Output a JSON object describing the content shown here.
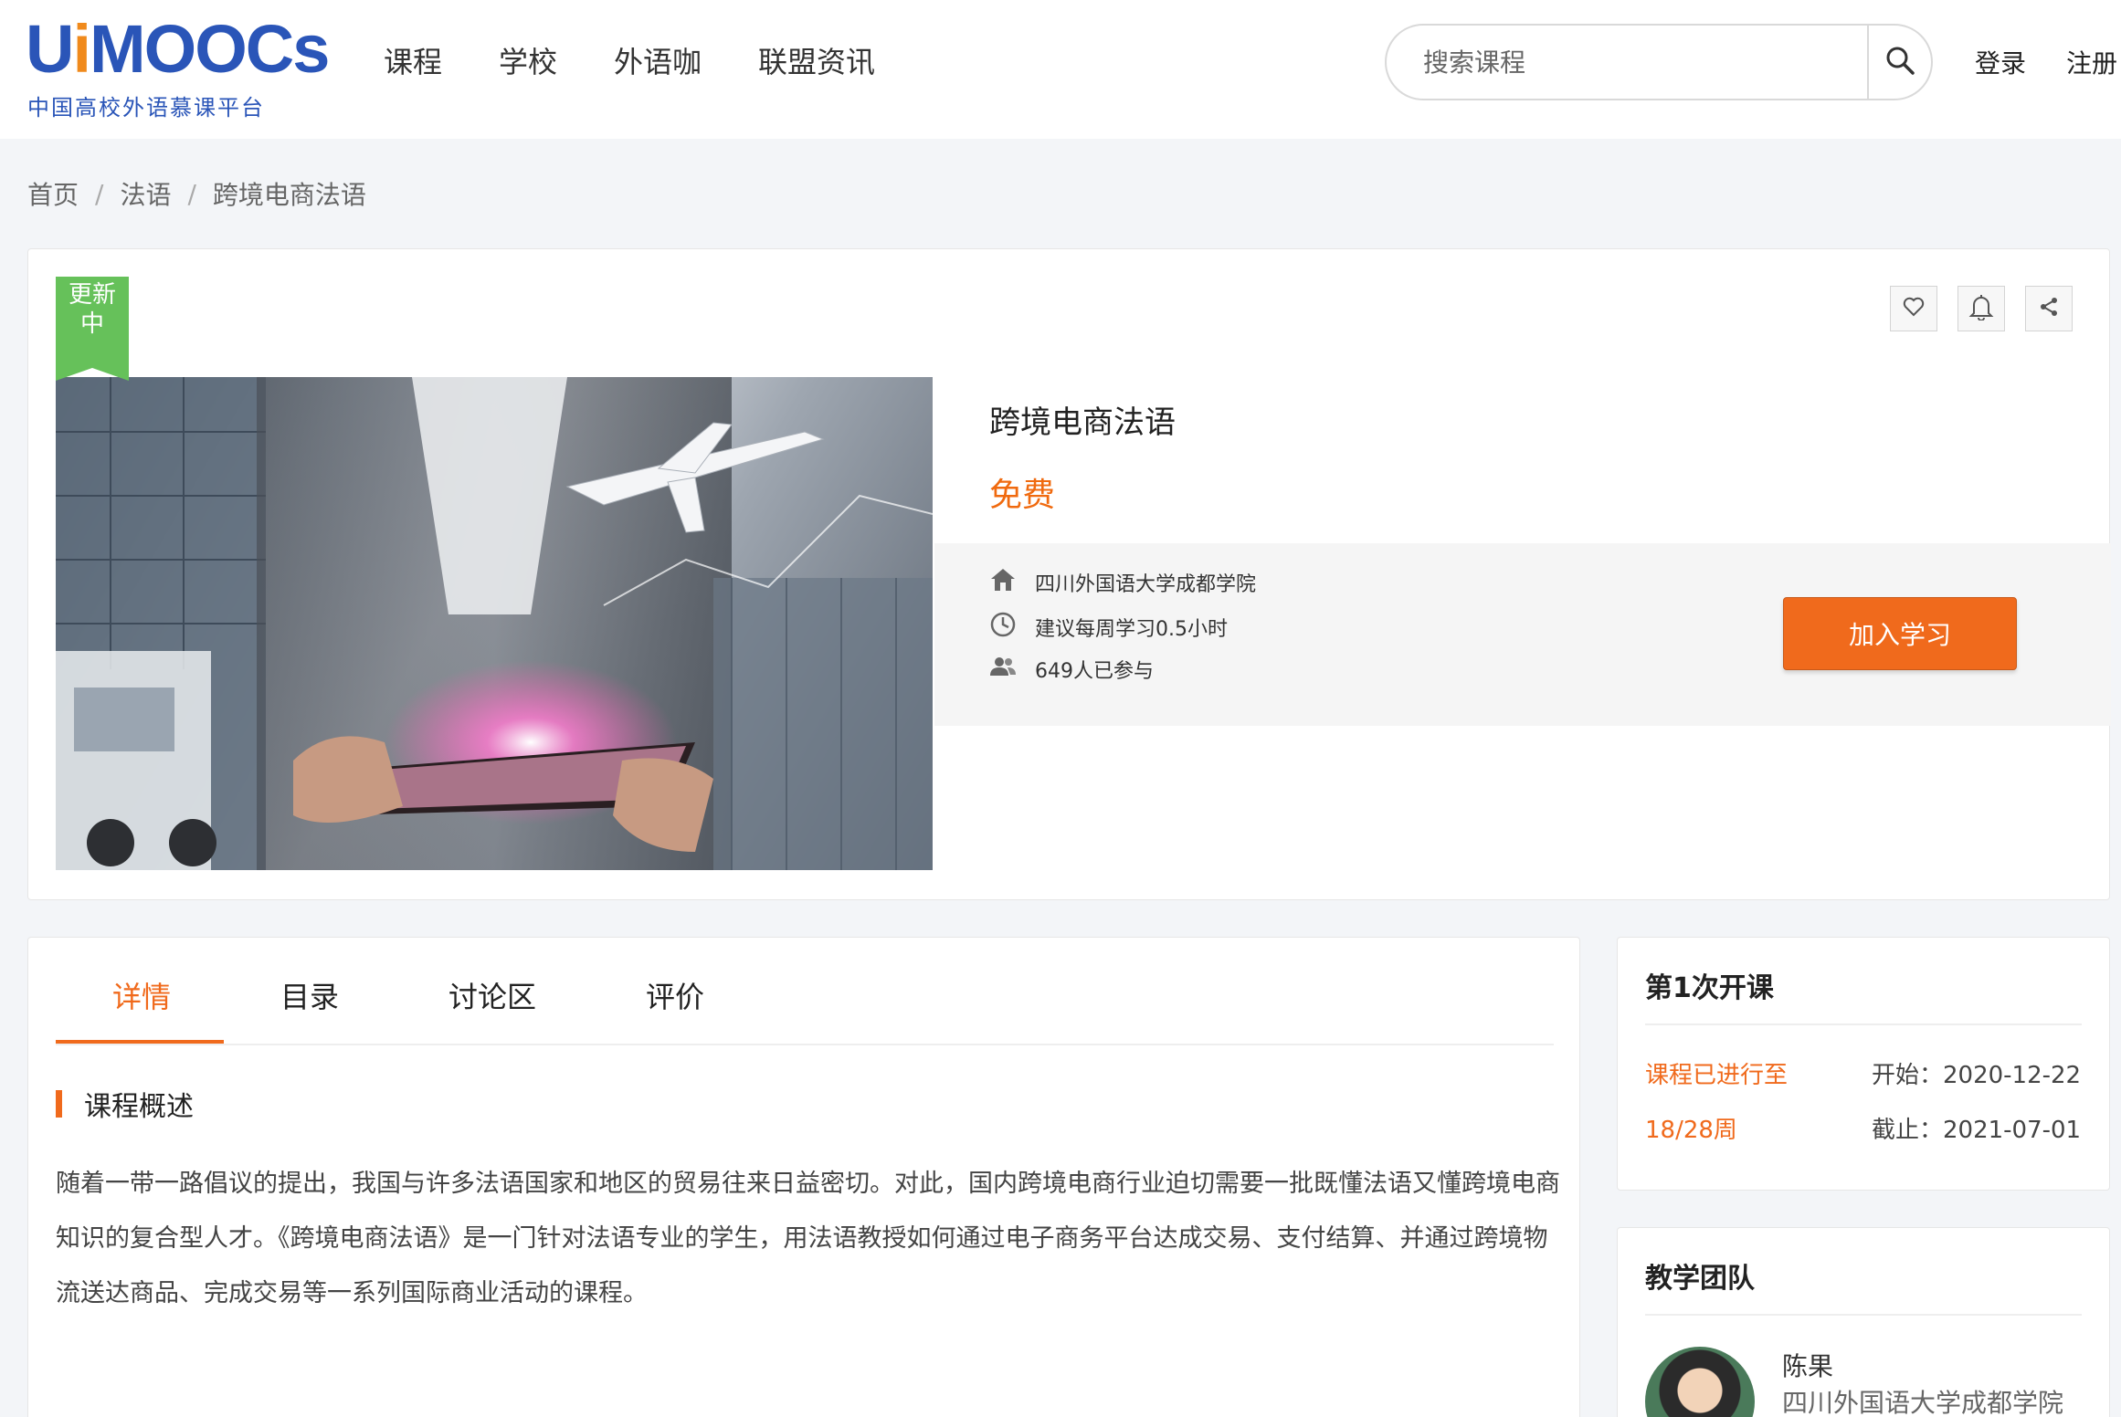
{
  "logo": {
    "word_blue_1": "U",
    "word_orange": "i",
    "word_blue_2": "MOOCs",
    "subtitle": "中国高校外语慕课平台"
  },
  "nav": {
    "items": [
      "课程",
      "学校",
      "外语咖",
      "联盟资讯"
    ]
  },
  "search": {
    "placeholder": "搜索课程",
    "icon": "search-icon"
  },
  "auth": {
    "login": "登录",
    "register": "注册"
  },
  "breadcrumb": {
    "items": [
      "首页",
      "法语",
      "跨境电商法语"
    ],
    "separator": "/"
  },
  "course": {
    "badge": "更新中",
    "badge_line1": "更新",
    "badge_line2": "中",
    "title": "跨境电商法语",
    "price": "免费",
    "school": "四川外国语大学成都学院",
    "weekly": "建议每周学习0.5小时",
    "participants": "649人已参与",
    "join_label": "加入学习",
    "actions": [
      "heart-icon",
      "bell-icon",
      "share-icon"
    ]
  },
  "tabs": {
    "items": [
      "详情",
      "目录",
      "讨论区",
      "评价"
    ],
    "active": "详情"
  },
  "overview": {
    "title": "课程概述",
    "text": "随着一带一路倡议的提出，我国与许多法语国家和地区的贸易往来日益密切。对此，国内跨境电商行业迫切需要一批既懂法语又懂跨境电商知识的复合型人才。《跨境电商法语》是一门针对法语专业的学生，用法语教授如何通过电子商务平台达成交易、支付结算、并通过跨境物流送达商品、完成交易等一系列国际商业活动的课程。"
  },
  "session": {
    "title": "第1次开课",
    "progress_label": "课程已进行至",
    "progress_value": "18/28周",
    "start": "开始：2020-12-22",
    "end": "截止：2021-07-01"
  },
  "team": {
    "title": "教学团队",
    "teacher_name": "陈果",
    "teacher_org": "四川外国语大学成都学院"
  },
  "colors": {
    "accent": "#f06a1c",
    "brand_blue": "#2a55b8",
    "badge_green": "#66c15a"
  }
}
